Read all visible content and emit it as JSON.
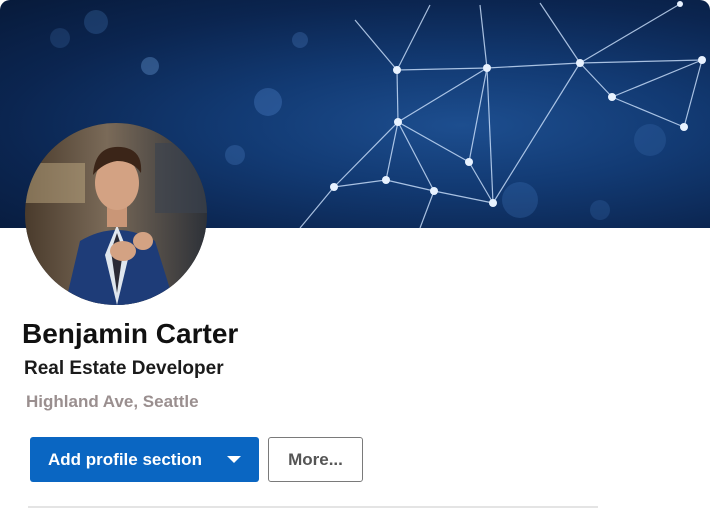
{
  "profile": {
    "name": "Benjamin Carter",
    "headline": "Real Estate Developer",
    "location": "Highland Ave, Seattle"
  },
  "actions": {
    "add_section_label": "Add profile section",
    "more_label": "More..."
  },
  "colors": {
    "primary_button": "#0a66c2",
    "banner_dark": "#0b2550",
    "location_text": "#9a8f8f"
  },
  "icons": {
    "dropdown": "caret-down-icon"
  }
}
